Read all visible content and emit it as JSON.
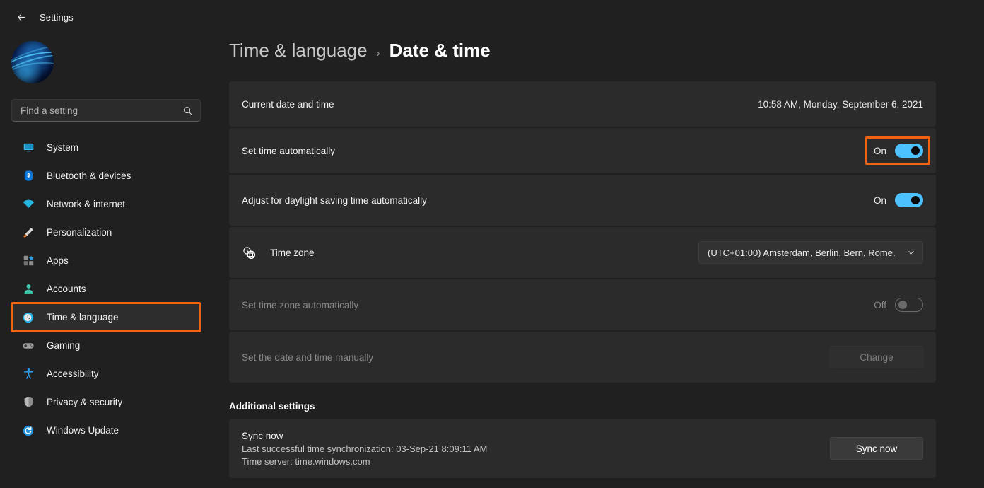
{
  "titlebar": {
    "back_icon": "arrow-left-icon",
    "title": "Settings"
  },
  "sidebar": {
    "avatar": "user-avatar",
    "search": {
      "placeholder": "Find a setting",
      "value": "",
      "icon": "search-icon"
    },
    "items": [
      {
        "label": "System",
        "icon": "monitor-icon",
        "selected": false
      },
      {
        "label": "Bluetooth & devices",
        "icon": "bluetooth-icon",
        "selected": false
      },
      {
        "label": "Network & internet",
        "icon": "wifi-icon",
        "selected": false
      },
      {
        "label": "Personalization",
        "icon": "paintbrush-icon",
        "selected": false
      },
      {
        "label": "Apps",
        "icon": "apps-grid-icon",
        "selected": false
      },
      {
        "label": "Accounts",
        "icon": "person-icon",
        "selected": false
      },
      {
        "label": "Time & language",
        "icon": "clock-icon",
        "selected": true
      },
      {
        "label": "Gaming",
        "icon": "gamepad-icon",
        "selected": false
      },
      {
        "label": "Accessibility",
        "icon": "accessibility-icon",
        "selected": false
      },
      {
        "label": "Privacy & security",
        "icon": "shield-icon",
        "selected": false
      },
      {
        "label": "Windows Update",
        "icon": "update-refresh-icon",
        "selected": false
      }
    ]
  },
  "breadcrumb": {
    "parent": "Time & language",
    "separator": "›",
    "current": "Date & time"
  },
  "rows": {
    "current_datetime": {
      "label": "Current date and time",
      "value": "10:58 AM, Monday, September 6, 2021"
    },
    "set_time_auto": {
      "label": "Set time automatically",
      "state": "On",
      "highlighted": true
    },
    "daylight_saving": {
      "label": "Adjust for daylight saving time automatically",
      "state": "On",
      "highlighted": false
    },
    "time_zone": {
      "label": "Time zone",
      "icon": "clock-globe-icon",
      "value": "(UTC+01:00) Amsterdam, Berlin, Bern, Rome,",
      "chevron": "chevron-down-icon"
    },
    "set_tz_auto": {
      "label": "Set time zone automatically",
      "state": "Off",
      "disabled": true
    },
    "set_manually": {
      "label": "Set the date and time manually",
      "button": "Change",
      "disabled": true
    }
  },
  "additional": {
    "heading": "Additional settings",
    "sync": {
      "title": "Sync now",
      "line1": "Last successful time synchronization: 03-Sep-21 8:09:11 AM",
      "line2": "Time server: time.windows.com",
      "button": "Sync now"
    }
  },
  "colors": {
    "accent_toggle": "#4cc2ff",
    "highlight": "#f2630f",
    "card_bg": "#2b2b2b",
    "page_bg": "#202020"
  }
}
